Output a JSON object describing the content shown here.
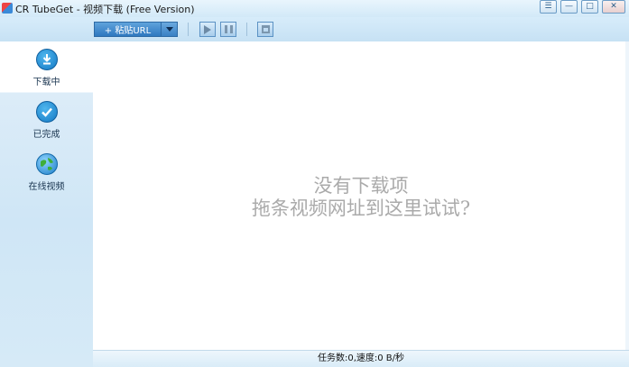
{
  "window": {
    "title": "CR TubeGet - 视频下载 (Free Version)",
    "controls": [
      "menu-icon",
      "minimize-icon",
      "maximize-icon",
      "close-icon"
    ]
  },
  "toolbar": {
    "paste_url_label": "+ 粘贴URL",
    "buttons": [
      "play-icon",
      "pause-icon",
      "delete-icon"
    ]
  },
  "sidebar": {
    "items": [
      {
        "label": "下载中",
        "icon": "download-icon",
        "selected": true
      },
      {
        "label": "已完成",
        "icon": "checkmark-icon",
        "selected": false
      },
      {
        "label": "在线视频",
        "icon": "globe-icon",
        "selected": false
      }
    ]
  },
  "main": {
    "empty_title": "没有下载项",
    "empty_hint": "拖条视频网址到这里试试?"
  },
  "status": {
    "text": "任务数:0,速度:0 B/秒"
  },
  "colors": {
    "accent": "#2f78bf",
    "chrome": "#cfe6f6",
    "empty_text": "#aaaaaa"
  }
}
